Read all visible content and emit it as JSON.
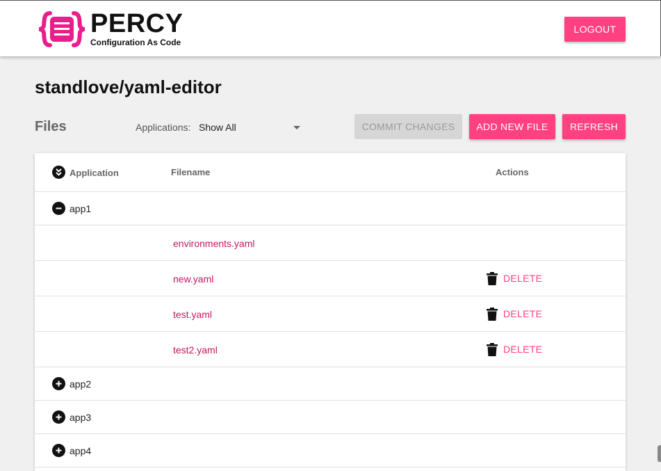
{
  "brand": {
    "name": "PERCY",
    "tagline": "Configuration As Code",
    "accent_color": "#ff4081",
    "mark_color": "#e91e8c"
  },
  "header": {
    "logout_label": "LOGOUT"
  },
  "repo": {
    "title": "standlove/yaml-editor"
  },
  "toolbar": {
    "files_label": "Files",
    "applications_label": "Applications:",
    "applications_selected": "Show All",
    "commit_label": "COMMIT CHANGES",
    "add_file_label": "ADD NEW FILE",
    "refresh_label": "REFRESH"
  },
  "table": {
    "columns": {
      "application": "Application",
      "filename": "Filename",
      "actions": "Actions"
    },
    "rows": [
      {
        "type": "app",
        "name": "app1",
        "expanded": true,
        "icon": "collapse-icon"
      },
      {
        "type": "file",
        "filename": "environments.yaml",
        "deletable": false
      },
      {
        "type": "file",
        "filename": "new.yaml",
        "deletable": true,
        "action_label": "DELETE"
      },
      {
        "type": "file",
        "filename": "test.yaml",
        "deletable": true,
        "action_label": "DELETE"
      },
      {
        "type": "file",
        "filename": "test2.yaml",
        "deletable": true,
        "action_label": "DELETE"
      },
      {
        "type": "app",
        "name": "app2",
        "expanded": false,
        "icon": "expand-icon"
      },
      {
        "type": "app",
        "name": "app3",
        "expanded": false,
        "icon": "expand-icon"
      },
      {
        "type": "app",
        "name": "app4",
        "expanded": false,
        "icon": "expand-icon"
      }
    ]
  }
}
